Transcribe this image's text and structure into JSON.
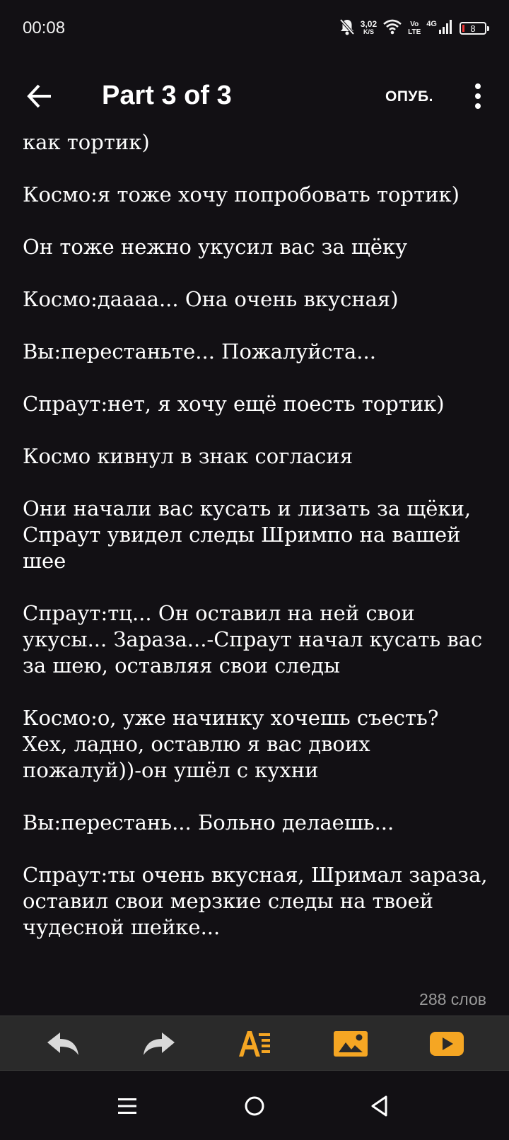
{
  "status_bar": {
    "time": "00:08",
    "net_speed_value": "3,02",
    "net_speed_unit": "K/S",
    "volte_top": "Vo",
    "volte_bottom": "LTE",
    "network": "4G",
    "battery": "8"
  },
  "app_bar": {
    "title": "Part 3 of 3",
    "publish_label": "ОПУБ."
  },
  "content": {
    "paragraphs": [
      "как тортик)",
      "Космо:я тоже хочу попробовать тортик)",
      "Он тоже нежно укусил вас за щёку",
      "Космо:даааа... Она очень вкусная)",
      "Вы:перестаньте... Пожалуйста...",
      "Спраут:нет, я хочу ещё поесть тортик)",
      "Космо кивнул в знак согласия",
      "Они начали вас кусать и лизать за щёки, Спраут увидел следы Шримпо на вашей шее",
      "Спраут:тц... Он оставил на ней свои укусы... Зараза...-Спраут начал кусать вас за шею, оставляя свои следы",
      "Космо:о, уже начинку хочешь съесть? Хех, ладно, оставлю я вас двоих пожалуй))-он ушёл с кухни",
      "Вы:перестань... Больно делаешь...",
      "Спраут:ты очень вкусная, Шримал зараза, оставил свои мерзкие следы на твоей чудесной шейке..."
    ]
  },
  "word_count": "288 слов",
  "toolbar": {
    "icons": [
      "undo-icon",
      "redo-icon",
      "text-format-icon",
      "image-icon",
      "video-icon"
    ],
    "accent_color": "#f5a623",
    "inactive_color": "#d9d9d9"
  },
  "nav_bar": {
    "icons": [
      "recent-apps-icon",
      "home-icon",
      "back-triangle-icon"
    ]
  }
}
